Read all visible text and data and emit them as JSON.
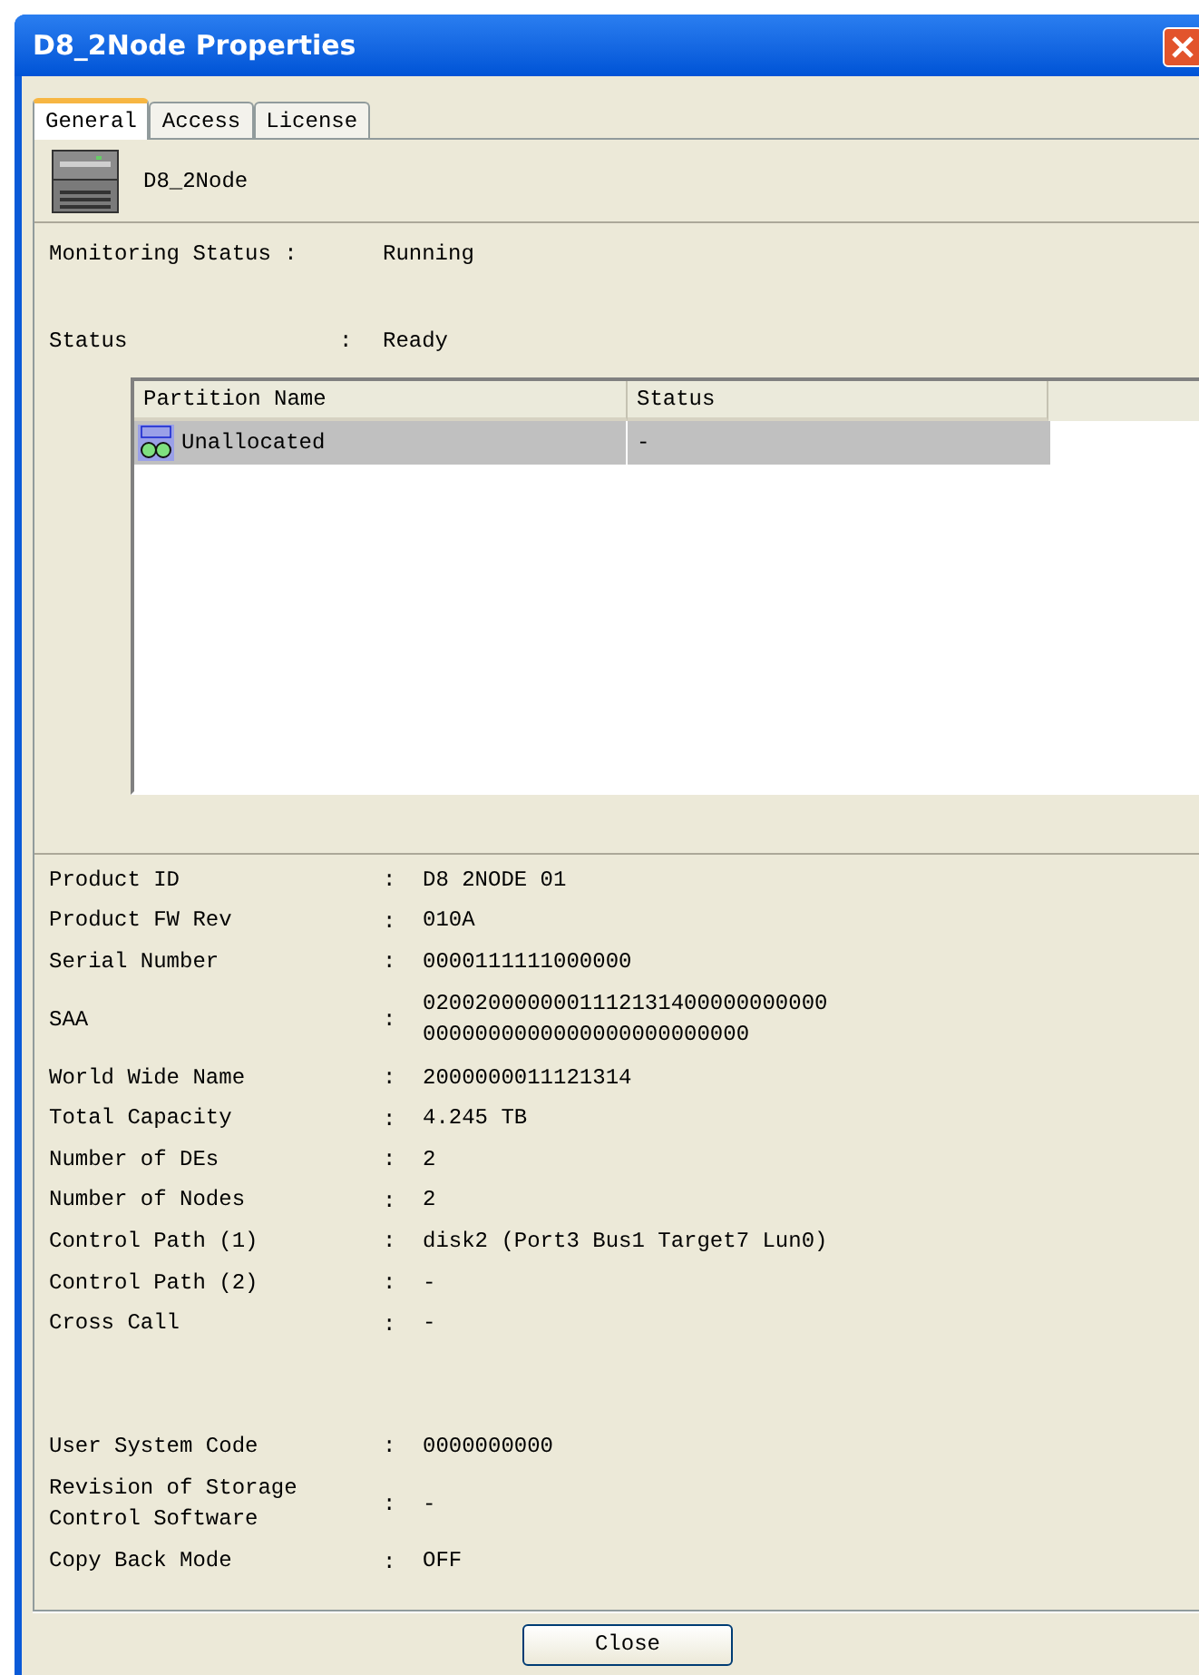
{
  "window": {
    "title": "D8_2Node Properties"
  },
  "tabs": [
    {
      "label": "General",
      "selected": true
    },
    {
      "label": "Access",
      "selected": false
    },
    {
      "label": "License",
      "selected": false
    }
  ],
  "device": {
    "name": "D8_2Node"
  },
  "monitoring_status": {
    "label": "Monitoring Status :",
    "value": "Running"
  },
  "status": {
    "label": "Status",
    "colon": ":",
    "value": "Ready"
  },
  "partitions": {
    "columns": [
      "Partition Name",
      "Status"
    ],
    "rows": [
      {
        "name": "Unallocated",
        "status": "-",
        "selected": true
      }
    ]
  },
  "properties": [
    {
      "label": "Product ID",
      "colon": ":",
      "value": "D8 2NODE 01"
    },
    {
      "label": "Product FW Rev",
      "colon": ":",
      "value": "010A"
    },
    {
      "label": "Serial Number",
      "colon": ":",
      "value": "0000111111000000"
    },
    {
      "label": "SAA",
      "colon": ":",
      "value": "0200200000001112131400000000000",
      "value_2": "0000000000000000000000000"
    },
    {
      "label": "World Wide Name",
      "colon": ":",
      "value": "2000000011121314"
    },
    {
      "label": "Total Capacity",
      "colon": ":",
      "value": "4.245 TB"
    },
    {
      "label": "Number of DEs",
      "colon": ":",
      "value": "2"
    },
    {
      "label": "Number of Nodes",
      "colon": ":",
      "value": "2"
    },
    {
      "label": "Control Path (1)",
      "colon": ":",
      "value": "disk2 (Port3 Bus1 Target7 Lun0)"
    },
    {
      "label": "Control Path (2)",
      "colon": ":",
      "value": "-"
    },
    {
      "label": "Cross Call",
      "colon": ":",
      "value": "-"
    }
  ],
  "properties_2": [
    {
      "label": "User System Code",
      "colon": ":",
      "value": "0000000000"
    },
    {
      "label": "Revision of Storage",
      "label_2": "Control Software",
      "colon": ":",
      "value": "-"
    },
    {
      "label": "Copy Back Mode",
      "colon": ":",
      "value": "OFF"
    }
  ],
  "buttons": [
    "Close"
  ]
}
